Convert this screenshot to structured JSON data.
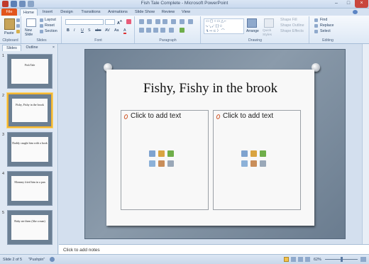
{
  "window": {
    "title": "Fish Tale Complete - Microsoft PowerPoint"
  },
  "tabs": [
    "File",
    "Home",
    "Insert",
    "Design",
    "Transitions",
    "Animations",
    "Slide Show",
    "Review",
    "View"
  ],
  "ribbon": {
    "clipboard": {
      "label": "Clipboard",
      "paste": "Paste"
    },
    "slides": {
      "label": "Slides",
      "new_slide": "New Slide",
      "layout": "Layout",
      "reset": "Reset",
      "section": "Section"
    },
    "font": {
      "label": "Font",
      "buttons": [
        "B",
        "I",
        "U",
        "S",
        "abc",
        "AV",
        "Aa",
        "A"
      ]
    },
    "paragraph": {
      "label": "Paragraph"
    },
    "drawing": {
      "label": "Drawing",
      "arrange": "Arrange",
      "quick_styles": "Quick Styles",
      "shape_fill": "Shape Fill",
      "shape_outline": "Shape Outline",
      "shape_effects": "Shape Effects"
    },
    "editing": {
      "label": "Editing",
      "find": "Find",
      "replace": "Replace",
      "select": "Select"
    }
  },
  "pane": {
    "tabs": [
      "Slides",
      "Outline"
    ],
    "close": "×",
    "thumbnails": [
      {
        "num": "1",
        "text": "Fish Tale"
      },
      {
        "num": "2",
        "text": "Fishy, Fishy in the brook"
      },
      {
        "num": "3",
        "text": "Daddy caught him with a hook"
      },
      {
        "num": "4",
        "text": "Mommy fried him in a pan"
      },
      {
        "num": "5",
        "text": "Baby ate them (like a man)"
      }
    ]
  },
  "slide": {
    "title": "Fishy, Fishy in the brook",
    "left_placeholder": "Click to add text",
    "right_placeholder": "Click to add text"
  },
  "notes": {
    "placeholder": "Click to add notes"
  },
  "status": {
    "slide": "Slide 2 of 5",
    "theme": "\"Pushpin\"",
    "zoom": "62%"
  },
  "colors": {
    "file_tab": "#e2551c",
    "selected_thumb": "#f2b530",
    "ribbon": "#dde8f5"
  }
}
